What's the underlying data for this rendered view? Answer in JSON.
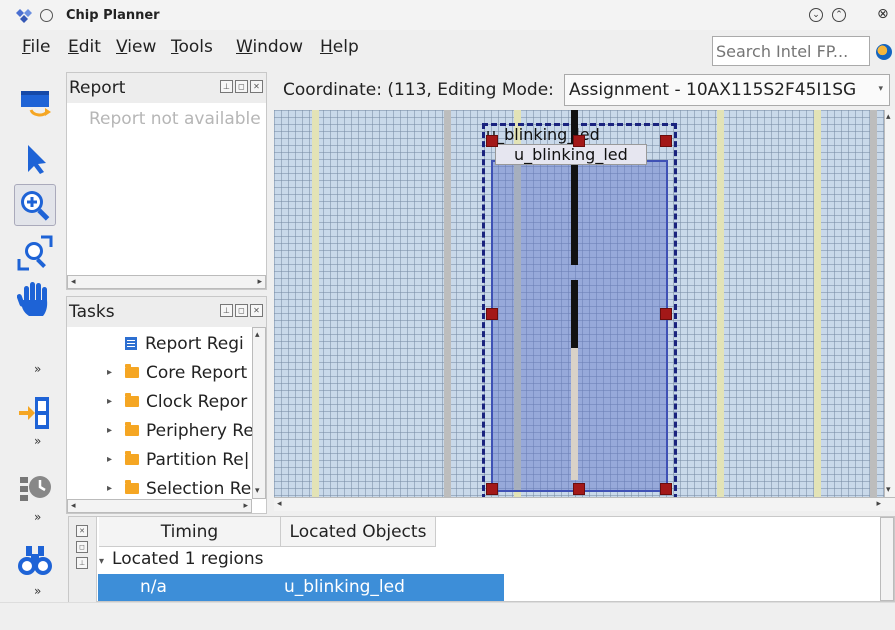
{
  "window": {
    "title": "Chip Planner"
  },
  "menu": [
    {
      "label": "File",
      "key": "F",
      "rest": "ile"
    },
    {
      "label": "Edit",
      "key": "E",
      "rest": "dit"
    },
    {
      "label": "View",
      "key": "V",
      "rest": "iew"
    },
    {
      "label": "Tools",
      "key": "T",
      "rest": "ools"
    },
    {
      "label": "Window",
      "key": "W",
      "rest": "indow"
    },
    {
      "label": "Help",
      "key": "H",
      "rest": "elp"
    }
  ],
  "search": {
    "placeholder": "Search Intel FP..."
  },
  "report_panel": {
    "title": "Report",
    "message": "Report not available"
  },
  "tasks_panel": {
    "title": "Tasks",
    "items": [
      {
        "label": "Report Regi",
        "icon": "document-icon",
        "expandable": false
      },
      {
        "label": "Core Report",
        "icon": "folder-icon",
        "expandable": true
      },
      {
        "label": "Clock Repor",
        "icon": "folder-icon",
        "expandable": true
      },
      {
        "label": "Periphery Re",
        "icon": "folder-icon",
        "expandable": true
      },
      {
        "label": "Partition Re|",
        "icon": "folder-icon",
        "expandable": true
      },
      {
        "label": "Selection Re",
        "icon": "folder-icon",
        "expandable": true
      }
    ]
  },
  "viewbar": {
    "coordinate": "Coordinate: (113,",
    "mode_label": "Editing Mode:",
    "mode_value": "Assignment - 10AX115S2F45I1SG"
  },
  "canvas": {
    "region_label": "u_blinking_led",
    "region_label_inner": "u_blinking_led"
  },
  "located": {
    "columns": [
      "Timing",
      "Located Objects"
    ],
    "group": "Located 1 regions",
    "rows": [
      {
        "timing": "n/a",
        "object": "u_blinking_led"
      }
    ]
  },
  "colors": {
    "selection": "#3d8ed8",
    "region_border": "#1a237e",
    "handle": "#a31818",
    "grid_bg": "#c9d9ea"
  },
  "toolbar_icons": [
    "floorplan-icon",
    "select-arrow-icon",
    "zoom-in-icon",
    "zoom-region-icon",
    "hand-pan-icon",
    "insert-column-icon",
    "timer-icon",
    "binoculars-icon"
  ]
}
